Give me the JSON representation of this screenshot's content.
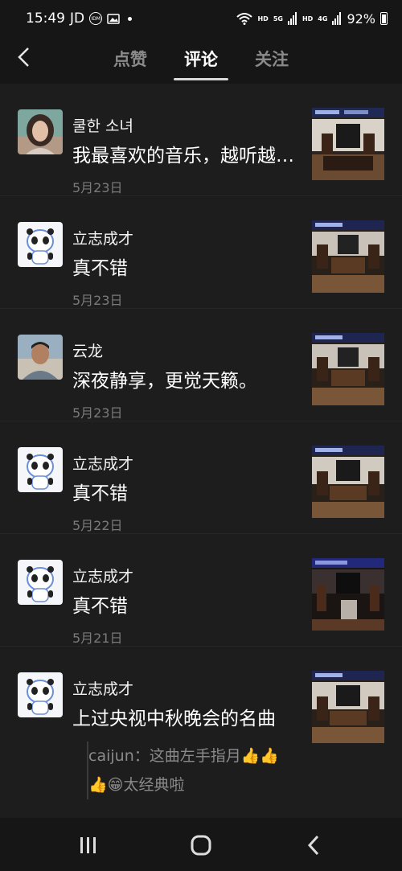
{
  "status": {
    "time": "15:49",
    "carrier": "JD",
    "idm": "IDM",
    "hd1": "HD",
    "net1": "5G",
    "hd2": "HD",
    "net2": "4G",
    "battery": "92%"
  },
  "header": {
    "tabs": [
      {
        "label": "点赞",
        "active": false
      },
      {
        "label": "评论",
        "active": true
      },
      {
        "label": "关注",
        "active": false
      }
    ]
  },
  "comments": [
    {
      "name": "쿨한 소녀",
      "content": "我最喜欢的音乐，越听越…",
      "date": "5月23日",
      "avatar": "girl-photo"
    },
    {
      "name": "立志成才",
      "content": "真不错",
      "date": "5月23日",
      "avatar": "panda-mascot"
    },
    {
      "name": "云龙",
      "content": "深夜静享，更觉天籁。",
      "date": "5月23日",
      "avatar": "man-photo"
    },
    {
      "name": "立志成才",
      "content": "真不错",
      "date": "5月22日",
      "avatar": "panda-mascot"
    },
    {
      "name": "立志成才",
      "content": "真不错",
      "date": "5月21日",
      "avatar": "panda-mascot"
    },
    {
      "name": "立志成才",
      "content": "上过央视中秋晚会的名曲",
      "avatar": "panda-mascot",
      "reply_line1": "caijun：这曲左手指月",
      "reply_line1_emoji": "👍👍",
      "reply_line2_emoji": "👍😁",
      "reply_line2": "太经典啦"
    }
  ],
  "colors": {
    "background": "#1d1d1d",
    "bar": "#161616",
    "muted": "#7a7a7a"
  }
}
